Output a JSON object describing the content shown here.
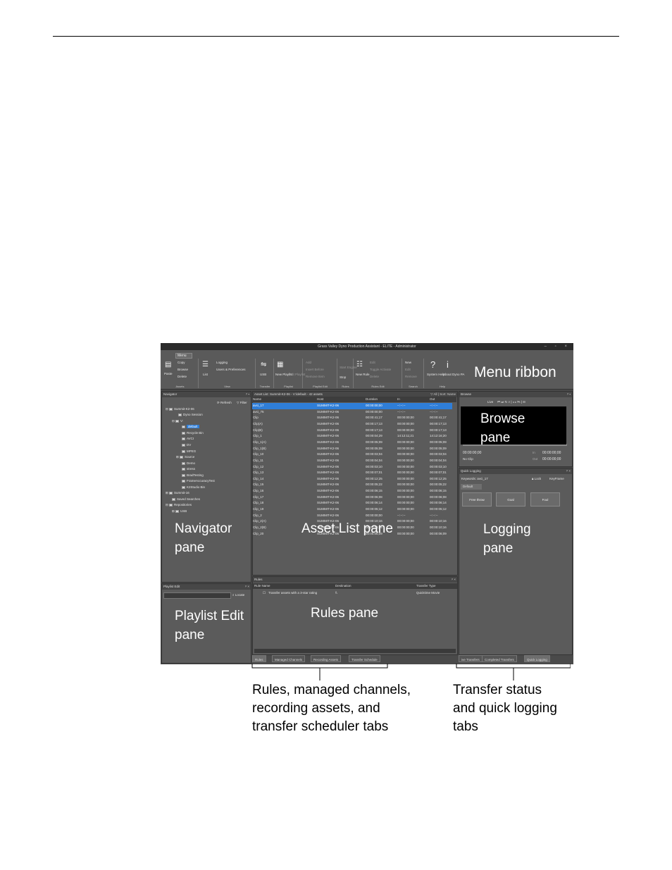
{
  "window": {
    "title": "Grass Valley Dyno Production Assistant - ELITE - Administrator",
    "controls": [
      "–",
      "▫",
      "×"
    ]
  },
  "ribbon": {
    "menu_tab": "Menu",
    "groups": [
      {
        "label": "Assets",
        "items": [
          "Paste",
          "Copy",
          "Browse",
          "Delete"
        ]
      },
      {
        "label": "View",
        "items": [
          "List",
          "Logging",
          "Users & Preferences"
        ]
      },
      {
        "label": "Transfer",
        "items": [
          "USB"
        ]
      },
      {
        "label": "Playlist",
        "items": [
          "New Playlist",
          "Edit Playlist"
        ]
      },
      {
        "label": "Playlist Edit",
        "items": [
          "Add",
          "Insert Before",
          "Remove Item"
        ]
      },
      {
        "label": "Rules",
        "items": [
          "Start Engine",
          "Stop"
        ]
      },
      {
        "label": "Rules Edit",
        "items": [
          "New Rule",
          "Edit",
          "Toggle Activate",
          "Delete"
        ]
      },
      {
        "label": "Search",
        "items": [
          "New",
          "Edit",
          "Remove"
        ]
      },
      {
        "label": "Help",
        "items": [
          "System Help",
          "About Dyno PA"
        ]
      }
    ],
    "callout": "Menu ribbon"
  },
  "navigator": {
    "title": "Navigator",
    "refresh": "Refresh",
    "filter": "Filter",
    "items": [
      "Summit-K2-06",
      "Dyno Session",
      "V:",
      "default",
      "Recycle Bin",
      "AVCI",
      "DV",
      "MPEG",
      "Source",
      "Demo",
      "stress",
      "BradTesting",
      "FrameAccuracyTest",
      "K2Studio Bin",
      "Summit-16",
      "Saved Searches",
      "Repositories",
      "USB"
    ],
    "callout": "Navigator\npane"
  },
  "playlist_edit": {
    "title": "Playlist Edit",
    "locate": "Locate",
    "callout": "Playlist Edit\npane"
  },
  "asset_list": {
    "title": "Asset List: Summit-K2-06 - V:\\default - 42 assets",
    "filter": "All",
    "sort": "Sort: Name",
    "columns": [
      "Name",
      "Host",
      "Duration",
      "In",
      "Out"
    ],
    "rows": [
      [
        "avci_17",
        "SUMMIT-K2-06",
        "00:00:00;00",
        "--:--:--",
        "--:--:--"
      ],
      [
        "avci_75",
        "SUMMIT-K2-06",
        "00:00:00;00",
        "--:--:--",
        "--:--:--"
      ],
      [
        "Clip",
        "SUMMIT-K2-06",
        "00:00:41;17",
        "00:00:00;00",
        "00:00:41;17"
      ],
      [
        "Clip(A)",
        "SUMMIT-K2-06",
        "00:00:17;13",
        "00:00:00;00",
        "00:00:17;13"
      ],
      [
        "Clip(B)",
        "SUMMIT-K2-06",
        "00:00:17;13",
        "00:00:00;00",
        "00:00:17;13"
      ],
      [
        "Clip_1",
        "SUMMIT-K2-06",
        "00:00:04;29",
        "14:12:11;21",
        "14:12:16;20"
      ],
      [
        "Clip_1(A)",
        "SUMMIT-K2-06",
        "00:00:05;09",
        "00:00:00;00",
        "00:00:05;09"
      ],
      [
        "Clip_1(B)",
        "SUMMIT-K2-06",
        "00:00:05;09",
        "00:00:00;00",
        "00:00:05;09"
      ],
      [
        "Clip_10",
        "SUMMIT-K2-06",
        "00:00:03;04",
        "00:00:00;00",
        "00:00:03;04"
      ],
      [
        "Clip_11",
        "SUMMIT-K2-06",
        "00:00:04;04",
        "00:00:00;00",
        "00:00:04;04"
      ],
      [
        "Clip_12",
        "SUMMIT-K2-06",
        "00:00:03;10",
        "00:00:00;00",
        "00:00:03;10"
      ],
      [
        "Clip_13",
        "SUMMIT-K2-06",
        "00:00:07;01",
        "00:00:00;00",
        "00:00:07;01"
      ],
      [
        "Clip_14",
        "SUMMIT-K2-06",
        "00:00:12;25",
        "00:00:00;00",
        "00:00:12;25"
      ],
      [
        "Clip_15",
        "SUMMIT-K2-06",
        "00:00:05;22",
        "00:00:00;00",
        "00:00:05;22"
      ],
      [
        "Clip_16",
        "SUMMIT-K2-06",
        "00:00:06;15",
        "00:00:00;00",
        "00:00:06;15"
      ],
      [
        "Clip_17",
        "SUMMIT-K2-06",
        "00:00:06;08",
        "00:00:00;00",
        "00:00:06;08"
      ],
      [
        "Clip_18",
        "SUMMIT-K2-06",
        "00:00:06;14",
        "00:00:00;00",
        "00:00:06;14"
      ],
      [
        "Clip_19",
        "SUMMIT-K2-06",
        "00:00:05;12",
        "00:00:00;00",
        "00:00:05;12"
      ],
      [
        "Clip_2",
        "SUMMIT-K2-06",
        "00:00:00;00",
        "--:--:--",
        "--:--:--"
      ],
      [
        "Clip_2(A)",
        "SUMMIT-K2-06",
        "00:00:10;16",
        "00:00:00;00",
        "00:00:10;16"
      ],
      [
        "Clip_2(B)",
        "SUMMIT-K2-06",
        "00:00:10;16",
        "00:00:00;00",
        "00:00:10;16"
      ],
      [
        "Clip_20",
        "SUMMIT-K2-06",
        "00:00:06;09",
        "00:00:00;00",
        "00:00:06;09"
      ]
    ],
    "callout": "Asset List pane"
  },
  "rules": {
    "title": "Rules",
    "columns": [
      "Rule Name",
      "Destination",
      "Transfer Type"
    ],
    "rows": [
      [
        "Transfer assets with a 3-star rating",
        "\\\\",
        "Quicktime Movie"
      ]
    ],
    "callout": "Rules pane"
  },
  "browse": {
    "title": "Browse",
    "live": "Live",
    "timecode": "00:00:00;00",
    "no_clip": "No Clip",
    "in_label": "In",
    "out_label": "Out",
    "in_tc": "00:00:00;00",
    "out_tc": "00:00:00;00",
    "callout": "Browse\npane"
  },
  "quick_logging": {
    "title": "Quick Logging",
    "keywords": "Keywords: avci_17",
    "lock": "Lock",
    "keyframe": "KeyFrame",
    "tab": "Default",
    "buttons": [
      "Free throw",
      "Goal",
      "Foul"
    ],
    "callout": "Logging\npane"
  },
  "bottom_tabs_left": [
    "Rules",
    "Managed Channels",
    "Recording Assets",
    "Transfer Schedule"
  ],
  "bottom_tabs_right": [
    "ive Transfers",
    "Completed Transfers",
    "Quick Logging"
  ],
  "captions": {
    "left": "Rules, managed channels,\nrecording assets, and\ntransfer scheduler tabs",
    "right": "Transfer status\nand quick logging\ntabs"
  }
}
